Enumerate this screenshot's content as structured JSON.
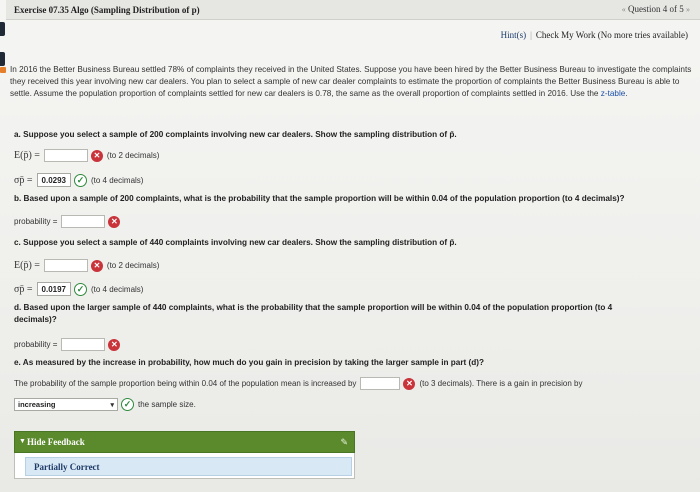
{
  "header": {
    "title": "Exercise 07.35 Algo (Sampling Distribution of p)",
    "question_nav": "Question 4 of 5"
  },
  "hints": {
    "hints_label": "Hint(s)",
    "check_label": "Check My Work (No more tries available)"
  },
  "intro": {
    "text_before": "In 2016 the Better Business Bureau settled 78% of complaints they received in the United States. Suppose you have been hired by the Better Business Bureau to investigate the complaints they received this year involving new car dealers. You plan to select a sample of new car dealer complaints to estimate the proportion of complaints the Better Business Bureau is able to settle. Assume the population proportion of complaints settled for new car dealers is 0.78, the same as the overall proportion of complaints settled in 2016. Use the ",
    "ztable_link": "z-table",
    "text_after": "."
  },
  "part_a": {
    "question": "a. Suppose you select a sample of 200 complaints involving new car dealers. Show the sampling distribution of p̄.",
    "ep_label": "E(p̄) =",
    "ep_note": "(to 2 decimals)",
    "sigma_label": "σp̄ =",
    "sigma_value": "0.0293",
    "sigma_note": "(to 4 decimals)"
  },
  "part_b": {
    "question": "b. Based upon a sample of 200 complaints, what is the probability that the sample proportion will be within 0.04 of the population proportion (to 4 decimals)?",
    "prob_label": "probability ="
  },
  "part_c": {
    "question": "c. Suppose you select a sample of 440 complaints involving new car dealers. Show the sampling distribution of p̄.",
    "ep_label": "E(p̄) =",
    "ep_note": "(to 2 decimals)",
    "sigma_label": "σp̄ =",
    "sigma_value": "0.0197",
    "sigma_note": "(to 4 decimals)"
  },
  "part_d": {
    "question_line1": "d. Based upon the larger sample of 440 complaints, what is the probability that the sample proportion will be within 0.04 of the population proportion (to 4",
    "question_line2": "decimals)?",
    "prob_label": "probability ="
  },
  "part_e": {
    "question": "e. As measured by the increase in probability, how much do you gain in precision by taking the larger sample in part (d)?",
    "statement_before": "The probability of the sample proportion being within 0.04 of the population mean is increased by",
    "statement_after": "(to 3 decimals). There is a gain in precision by",
    "select_value": "increasing",
    "select_after": "the sample size."
  },
  "feedback": {
    "toggle_label": "Hide Feedback",
    "result": "Partially Correct"
  },
  "colors": {
    "wrong": "#c9343a",
    "correct": "#2f8a3c",
    "feedback_bar": "#5a8a2c",
    "feedback_box": "#d9e8f5"
  }
}
